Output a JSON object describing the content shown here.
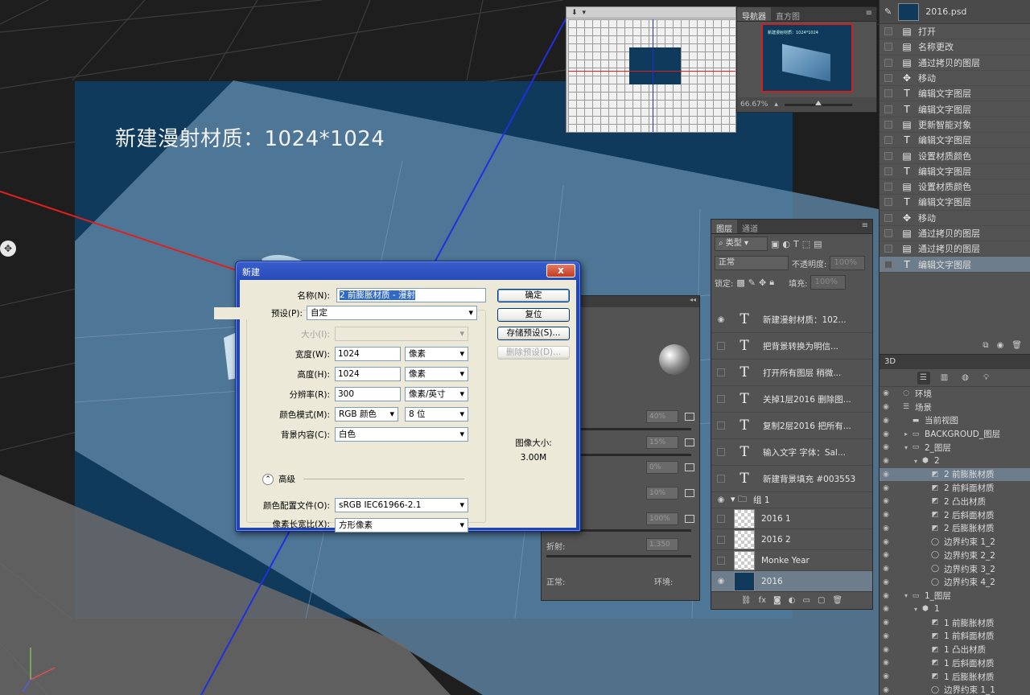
{
  "canvas": {
    "caption": "新建漫射材质：1024*1024",
    "orbit_icon": "orbit-icon"
  },
  "navigator": {
    "tabs": [
      "导航器",
      "直方图"
    ],
    "zoom": "66.67%",
    "preview_text": "新建漫射材质：1024*1024"
  },
  "history": {
    "document": "2016.psd",
    "items": [
      {
        "icon": "doc",
        "label": "打开"
      },
      {
        "icon": "doc",
        "label": "名称更改"
      },
      {
        "icon": "doc",
        "label": "通过拷贝的图层"
      },
      {
        "icon": "move",
        "label": "移动"
      },
      {
        "icon": "text",
        "label": "编辑文字图层"
      },
      {
        "icon": "text",
        "label": "编辑文字图层"
      },
      {
        "icon": "doc",
        "label": "更新智能对象"
      },
      {
        "icon": "text",
        "label": "编辑文字图层"
      },
      {
        "icon": "doc",
        "label": "设置材质颜色"
      },
      {
        "icon": "text",
        "label": "编辑文字图层"
      },
      {
        "icon": "doc",
        "label": "设置材质颜色"
      },
      {
        "icon": "text",
        "label": "编辑文字图层"
      },
      {
        "icon": "move",
        "label": "移动"
      },
      {
        "icon": "doc",
        "label": "通过拷贝的图层"
      },
      {
        "icon": "doc",
        "label": "通过拷贝的图层"
      },
      {
        "icon": "text",
        "label": "编辑文字图层",
        "selected": true
      }
    ]
  },
  "threed": {
    "title": "3D",
    "tree": [
      {
        "level": 0,
        "toggle": "",
        "icon": "env",
        "label": "环境"
      },
      {
        "level": 0,
        "toggle": "",
        "icon": "scene",
        "label": "场景"
      },
      {
        "level": 1,
        "toggle": "",
        "icon": "camera",
        "label": "当前视图"
      },
      {
        "level": 1,
        "toggle": "▸",
        "icon": "layer",
        "label": "BACKGROUD_图层"
      },
      {
        "level": 1,
        "toggle": "▾",
        "icon": "layer",
        "label": "2_图层"
      },
      {
        "level": 2,
        "toggle": "▾",
        "icon": "mesh",
        "label": "2"
      },
      {
        "level": 3,
        "toggle": "",
        "icon": "mat",
        "label": "2 前膨胀材质",
        "selected": true
      },
      {
        "level": 3,
        "toggle": "",
        "icon": "mat",
        "label": "2 前斜面材质"
      },
      {
        "level": 3,
        "toggle": "",
        "icon": "mat",
        "label": "2 凸出材质"
      },
      {
        "level": 3,
        "toggle": "",
        "icon": "mat",
        "label": "2 后斜面材质"
      },
      {
        "level": 3,
        "toggle": "",
        "icon": "mat",
        "label": "2 后膨胀材质"
      },
      {
        "level": 3,
        "toggle": "",
        "icon": "constraint",
        "label": "边界约束 1_2"
      },
      {
        "level": 3,
        "toggle": "",
        "icon": "constraint",
        "label": "边界约束 2_2"
      },
      {
        "level": 3,
        "toggle": "",
        "icon": "constraint",
        "label": "边界约束 3_2"
      },
      {
        "level": 3,
        "toggle": "",
        "icon": "constraint",
        "label": "边界约束 4_2"
      },
      {
        "level": 1,
        "toggle": "▾",
        "icon": "layer",
        "label": "1_图层"
      },
      {
        "level": 2,
        "toggle": "▾",
        "icon": "mesh",
        "label": "1"
      },
      {
        "level": 3,
        "toggle": "",
        "icon": "mat",
        "label": "1 前膨胀材质"
      },
      {
        "level": 3,
        "toggle": "",
        "icon": "mat",
        "label": "1 前斜面材质"
      },
      {
        "level": 3,
        "toggle": "",
        "icon": "mat",
        "label": "1 凸出材质"
      },
      {
        "level": 3,
        "toggle": "",
        "icon": "mat",
        "label": "1 后斜面材质"
      },
      {
        "level": 3,
        "toggle": "",
        "icon": "mat",
        "label": "1 后膨胀材质"
      },
      {
        "level": 3,
        "toggle": "",
        "icon": "constraint",
        "label": "边界约束 1_1"
      }
    ]
  },
  "layers": {
    "tabs": [
      "图层",
      "通道"
    ],
    "filter_label": "类型",
    "blend_mode": "正常",
    "opacity_label": "不透明度:",
    "opacity_value": "100%",
    "lock_label": "锁定:",
    "fill_label": "填充:",
    "fill_value": "100%",
    "rows": [
      {
        "type": "text",
        "eye": true,
        "label": "新建漫射材质：102..."
      },
      {
        "type": "text",
        "eye": false,
        "label": "把背景转换为明信..."
      },
      {
        "type": "text",
        "eye": false,
        "label": "打开所有图层 稍微..."
      },
      {
        "type": "text",
        "eye": false,
        "label": "关掉1层2016 删除图..."
      },
      {
        "type": "text",
        "eye": false,
        "label": "复制2层2016 把所有..."
      },
      {
        "type": "text",
        "eye": false,
        "label": "输入文字 字体：Sal..."
      },
      {
        "type": "text",
        "eye": false,
        "label": "新建背景填充 #003553"
      },
      {
        "type": "group",
        "eye": true,
        "label": "组 1"
      },
      {
        "type": "pixel",
        "eye": false,
        "label": "2016 1"
      },
      {
        "type": "pixel",
        "eye": false,
        "label": "2016 2"
      },
      {
        "type": "pixel",
        "eye": false,
        "label": "Monke Year"
      },
      {
        "type": "pixel-dark",
        "eye": true,
        "label": "2016",
        "selected": true
      }
    ]
  },
  "properties": {
    "fields": [
      "40%",
      "15%",
      "0%",
      "10%",
      "100%",
      "1.350"
    ],
    "refraction_label": "折射:",
    "normal_label": "正常:",
    "env_label": "环境:"
  },
  "dialog": {
    "title": "新建",
    "close_label": "x",
    "name_label": "名称(N):",
    "name_value": "2 前膨胀材质 - 漫射",
    "preset_label": "预设(P):",
    "preset_value": "自定",
    "size_label": "大小(I):",
    "width_label": "宽度(W):",
    "width_value": "1024",
    "width_unit": "像素",
    "height_label": "高度(H):",
    "height_value": "1024",
    "height_unit": "像素",
    "resolution_label": "分辨率(R):",
    "resolution_value": "300",
    "resolution_unit": "像素/英寸",
    "color_mode_label": "颜色模式(M):",
    "color_mode_value": "RGB 颜色",
    "bit_depth_value": "8 位",
    "background_label": "背景内容(C):",
    "background_value": "白色",
    "advanced_label": "高级",
    "profile_label": "颜色配置文件(O):",
    "profile_value": "sRGB IEC61966-2.1",
    "pixel_aspect_label": "像素长宽比(X):",
    "pixel_aspect_value": "方形像素",
    "ok_label": "确定",
    "reset_label": "复位",
    "save_preset_label": "存储预设(S)...",
    "delete_preset_label": "删除预设(D)...",
    "image_size_label": "图像大小:",
    "image_size_value": "3.00M"
  }
}
